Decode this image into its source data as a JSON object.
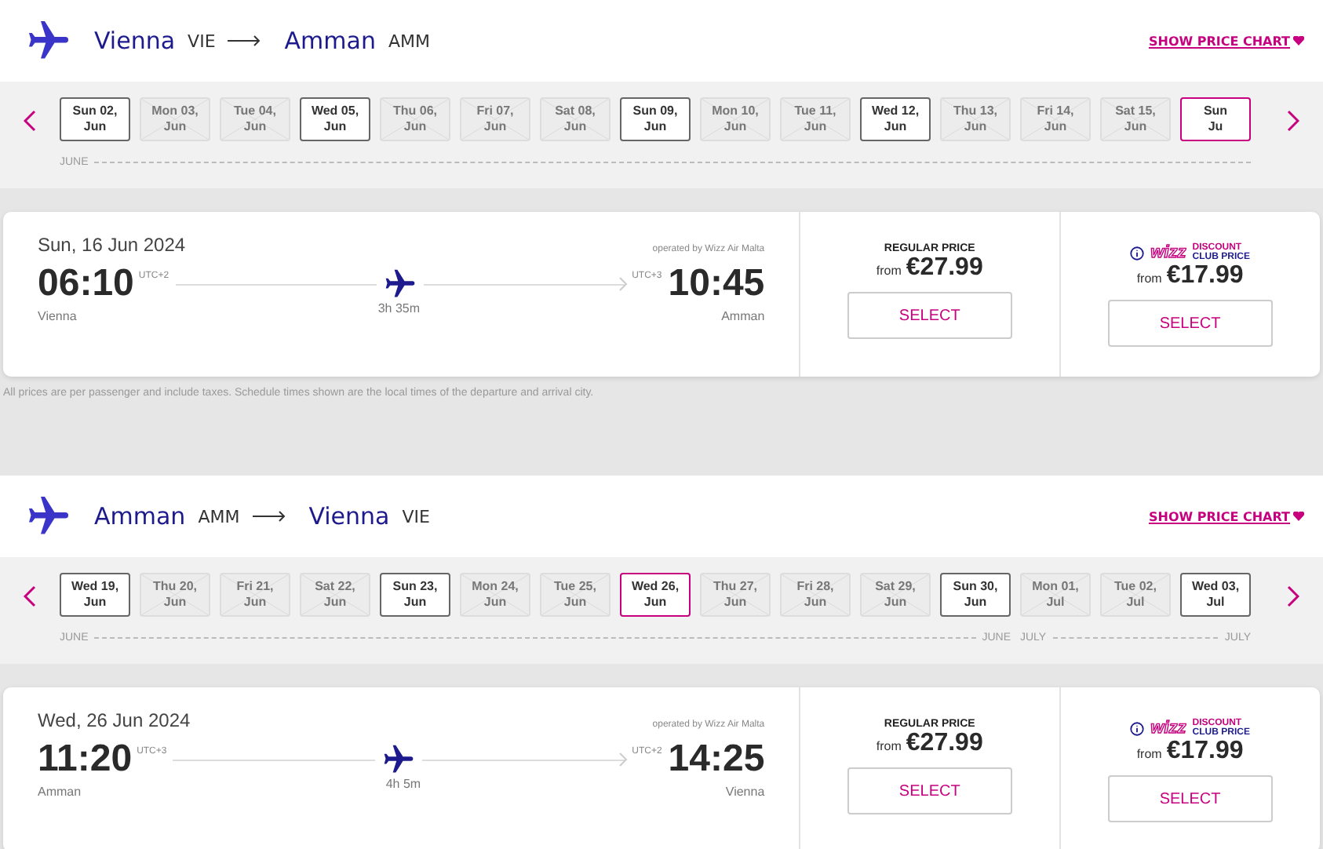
{
  "legs": [
    {
      "from_city": "Vienna",
      "from_code": "VIE",
      "to_city": "Amman",
      "to_code": "AMM",
      "price_chart_link": "SHOW PRICE CHART",
      "months": [
        {
          "start_label": "JUNE",
          "dates": [
            {
              "day": "Sun 02,",
              "month": "Jun",
              "available": true,
              "selected": false
            },
            {
              "day": "Mon 03,",
              "month": "Jun",
              "available": false,
              "selected": false
            },
            {
              "day": "Tue 04,",
              "month": "Jun",
              "available": false,
              "selected": false
            },
            {
              "day": "Wed 05,",
              "month": "Jun",
              "available": true,
              "selected": false
            },
            {
              "day": "Thu 06,",
              "month": "Jun",
              "available": false,
              "selected": false
            },
            {
              "day": "Fri 07,",
              "month": "Jun",
              "available": false,
              "selected": false
            },
            {
              "day": "Sat 08,",
              "month": "Jun",
              "available": false,
              "selected": false
            },
            {
              "day": "Sun 09,",
              "month": "Jun",
              "available": true,
              "selected": false
            },
            {
              "day": "Mon 10,",
              "month": "Jun",
              "available": false,
              "selected": false
            },
            {
              "day": "Tue 11,",
              "month": "Jun",
              "available": false,
              "selected": false
            },
            {
              "day": "Wed 12,",
              "month": "Jun",
              "available": true,
              "selected": false
            },
            {
              "day": "Thu 13,",
              "month": "Jun",
              "available": false,
              "selected": false
            },
            {
              "day": "Fri 14,",
              "month": "Jun",
              "available": false,
              "selected": false
            },
            {
              "day": "Sat 15,",
              "month": "Jun",
              "available": false,
              "selected": false
            },
            {
              "day": "Sun",
              "month": "Ju",
              "available": true,
              "selected": true
            }
          ]
        }
      ],
      "flight": {
        "date": "Sun, 16 Jun 2024",
        "operated_by": "operated by Wizz Air Malta",
        "dep_time": "06:10",
        "dep_utc": "UTC+2",
        "arr_utc": "UTC+3",
        "arr_time": "10:45",
        "duration": "3h 35m",
        "dep_city": "Vienna",
        "arr_city": "Amman",
        "fares": [
          {
            "kind": "regular",
            "label": "REGULAR PRICE",
            "from": "from",
            "price": "€27.99",
            "button": "SELECT"
          },
          {
            "kind": "club",
            "logo_word": "wizz",
            "logo_top": "DISCOUNT",
            "logo_bottom_1": "CLUB",
            "logo_bottom_2": "PRICE",
            "from": "from",
            "price": "€17.99",
            "button": "SELECT"
          }
        ]
      },
      "note": "All prices are per passenger and include taxes. Schedule times shown are the local times of the departure and arrival city."
    },
    {
      "from_city": "Amman",
      "from_code": "AMM",
      "to_city": "Vienna",
      "to_code": "VIE",
      "price_chart_link": "SHOW PRICE CHART",
      "months": [
        {
          "start_label": "JUNE",
          "end_label": "JUNE",
          "dates": [
            {
              "day": "Wed 19,",
              "month": "Jun",
              "available": true,
              "selected": false
            },
            {
              "day": "Thu 20,",
              "month": "Jun",
              "available": false,
              "selected": false
            },
            {
              "day": "Fri 21,",
              "month": "Jun",
              "available": false,
              "selected": false
            },
            {
              "day": "Sat 22,",
              "month": "Jun",
              "available": false,
              "selected": false
            },
            {
              "day": "Sun 23,",
              "month": "Jun",
              "available": true,
              "selected": false
            },
            {
              "day": "Mon 24,",
              "month": "Jun",
              "available": false,
              "selected": false
            },
            {
              "day": "Tue 25,",
              "month": "Jun",
              "available": false,
              "selected": false
            },
            {
              "day": "Wed 26,",
              "month": "Jun",
              "available": true,
              "selected": true
            },
            {
              "day": "Thu 27,",
              "month": "Jun",
              "available": false,
              "selected": false
            },
            {
              "day": "Fri 28,",
              "month": "Jun",
              "available": false,
              "selected": false
            },
            {
              "day": "Sat 29,",
              "month": "Jun",
              "available": false,
              "selected": false
            },
            {
              "day": "Sun 30,",
              "month": "Jun",
              "available": true,
              "selected": false
            }
          ]
        },
        {
          "start_label": "JULY",
          "end_label": "JULY",
          "dates": [
            {
              "day": "Mon 01,",
              "month": "Jul",
              "available": false,
              "selected": false
            },
            {
              "day": "Tue 02,",
              "month": "Jul",
              "available": false,
              "selected": false
            },
            {
              "day": "Wed 03,",
              "month": "Jul",
              "available": true,
              "selected": false
            }
          ]
        }
      ],
      "flight": {
        "date": "Wed, 26 Jun 2024",
        "operated_by": "operated by Wizz Air Malta",
        "dep_time": "11:20",
        "dep_utc": "UTC+3",
        "arr_utc": "UTC+2",
        "arr_time": "14:25",
        "duration": "4h 5m",
        "dep_city": "Amman",
        "arr_city": "Vienna",
        "fares": [
          {
            "kind": "regular",
            "label": "REGULAR PRICE",
            "from": "from",
            "price": "€27.99",
            "button": "SELECT"
          },
          {
            "kind": "club",
            "logo_word": "wizz",
            "logo_top": "DISCOUNT",
            "logo_bottom_1": "CLUB",
            "logo_bottom_2": "PRICE",
            "from": "from",
            "price": "€17.99",
            "button": "SELECT"
          }
        ]
      }
    }
  ]
}
